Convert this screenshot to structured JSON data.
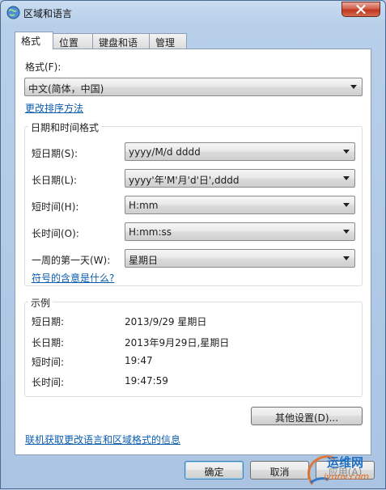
{
  "window": {
    "title": "区域和语言"
  },
  "tabs": [
    "格式",
    "位置",
    "键盘和语言",
    "管理"
  ],
  "format": {
    "label": "格式(F):",
    "value": "中文(简体，中国)"
  },
  "sort_link": "更改排序方法",
  "datetime_group": {
    "title": "日期和时间格式",
    "rows": [
      {
        "label": "短日期(S):",
        "value": "yyyy/M/d dddd"
      },
      {
        "label": "长日期(L):",
        "value": "yyyy'年'M'月'd'日',dddd"
      },
      {
        "label": "短时间(H):",
        "value": "H:mm"
      },
      {
        "label": "长时间(O):",
        "value": "H:mm:ss"
      },
      {
        "label": "一周的第一天(W):",
        "value": "星期日"
      }
    ],
    "symbols_link": "符号的含意是什么?"
  },
  "examples_group": {
    "title": "示例",
    "rows": [
      {
        "label": "短日期:",
        "value": "2013/9/29 星期日"
      },
      {
        "label": "长日期:",
        "value": "2013年9月29日,星期日"
      },
      {
        "label": "短时间:",
        "value": "19:47"
      },
      {
        "label": "长时间:",
        "value": "19:47:59"
      }
    ]
  },
  "other_settings_button": "其他设置(D)...",
  "online_link": "联机获取更改语言和区域格式的信息",
  "buttons": {
    "ok": "确定",
    "cancel": "取消",
    "apply": "应用(A)"
  },
  "watermark": {
    "line1": "运维网",
    "line2": "iyunv.com"
  },
  "colors": {
    "link": "#0b5cad",
    "close": "#c0361e",
    "frame": "#b7cfe9"
  },
  "icons": {
    "app": "globe-icon",
    "close": "close-icon",
    "dropdown": "chevron-down-icon"
  }
}
